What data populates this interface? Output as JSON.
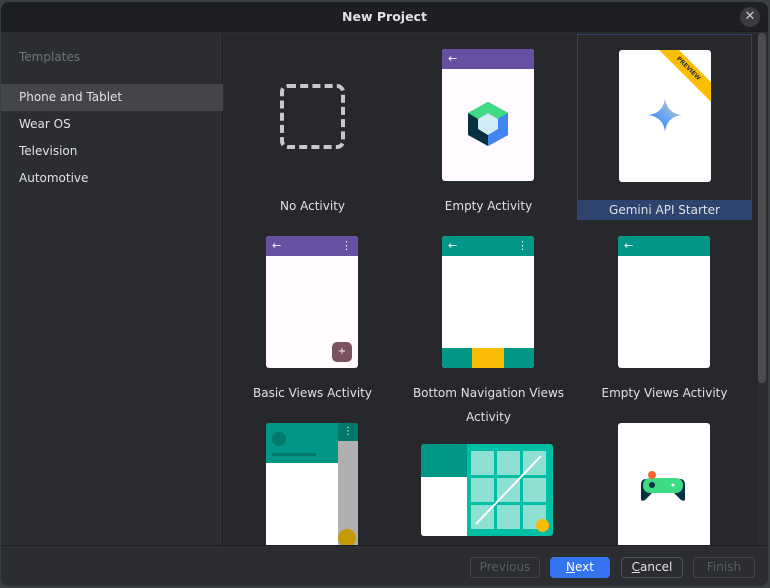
{
  "dialog": {
    "title": "New Project",
    "close_icon": "close-icon"
  },
  "sidebar": {
    "header": "Templates",
    "items": [
      {
        "label": "Phone and Tablet",
        "selected": true
      },
      {
        "label": "Wear OS"
      },
      {
        "label": "Television"
      },
      {
        "label": "Automotive"
      }
    ]
  },
  "templates": [
    {
      "label": "No Activity"
    },
    {
      "label": "Empty Activity"
    },
    {
      "label": "Gemini API Starter",
      "badge": "PREVIEW",
      "selected": true
    },
    {
      "label": "Basic Views Activity"
    },
    {
      "label": "Bottom Navigation Views Activity"
    },
    {
      "label": "Empty Views Activity"
    }
  ],
  "footer": {
    "previous": "Previous",
    "next_mnemonic": "N",
    "next_rest": "ext",
    "cancel_mnemonic": "C",
    "cancel_rest": "ancel",
    "finish": "Finish"
  },
  "colors": {
    "accent": "#3574f0",
    "purple": "#6750a4",
    "teal": "#009688",
    "amber": "#fbbc04"
  }
}
